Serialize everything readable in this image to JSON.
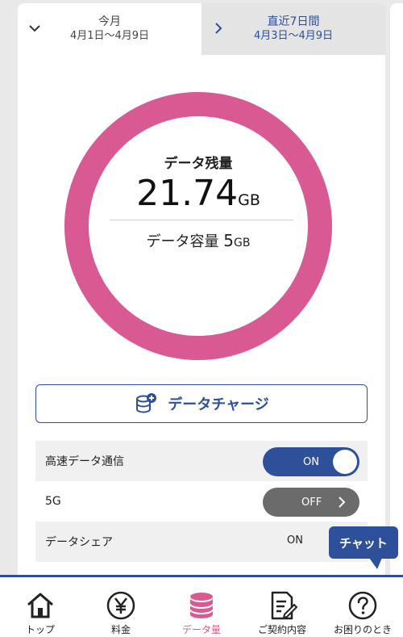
{
  "tabs": [
    {
      "title": "今月",
      "range": "4月1日〜4月9日"
    },
    {
      "title": "直近7日間",
      "range": "4月3日〜4月9日"
    }
  ],
  "remaining": {
    "label": "データ残量",
    "value": "21.74",
    "unit": "GB",
    "capacity_label": "データ容量",
    "capacity_value": "5",
    "capacity_unit": "GB",
    "fraction_remaining": 1.0
  },
  "charge_button": {
    "label": "データチャージ"
  },
  "settings": [
    {
      "label": "高速データ通信",
      "state": "ON"
    },
    {
      "label": "5G",
      "state": "OFF"
    },
    {
      "label": "データシェア",
      "state": "ON"
    }
  ],
  "chat": {
    "label": "チャット"
  },
  "nav": [
    {
      "label": "トップ",
      "icon": "home-icon"
    },
    {
      "label": "料金",
      "icon": "yen-icon"
    },
    {
      "label": "データ量",
      "icon": "database-icon"
    },
    {
      "label": "ご契約内容",
      "icon": "contract-icon"
    },
    {
      "label": "お困りのとき",
      "icon": "help-icon"
    }
  ],
  "colors": {
    "accent": "#2e4f9a",
    "ring": "#d95a93",
    "active_nav": "#d95a93"
  }
}
